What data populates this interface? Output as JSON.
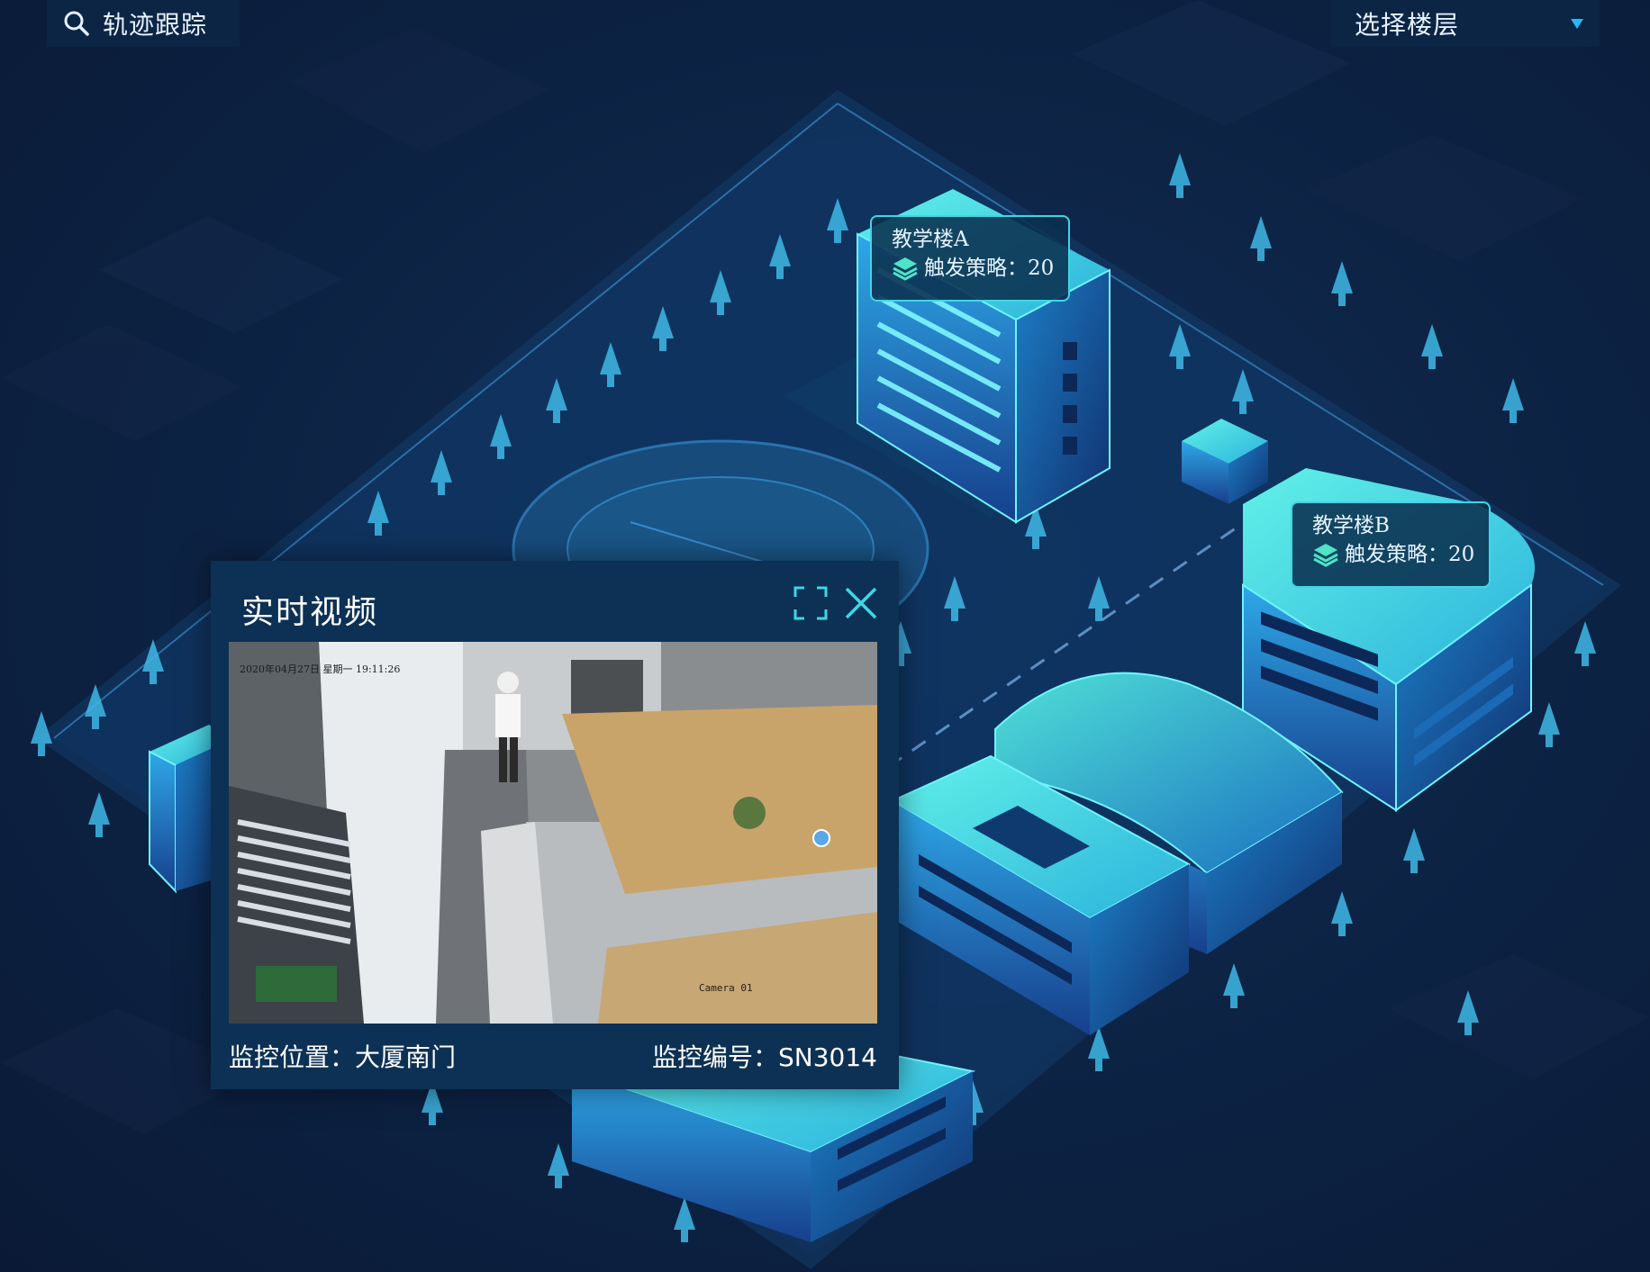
{
  "toolbar": {
    "search_label": "轨迹跟踪",
    "search_icon": "search-icon",
    "floor_select_value": "选择楼层",
    "floor_select_icon": "caret-down-icon"
  },
  "buildings": [
    {
      "name": "教学楼A",
      "strategy_label": "触发策略：",
      "strategy_count": "20",
      "icon": "layers-icon"
    },
    {
      "name": "教学楼B",
      "strategy_label": "触发策略：",
      "strategy_count": "20",
      "icon": "layers-icon"
    }
  ],
  "video_panel": {
    "title": "实时视频",
    "fullscreen_icon": "fullscreen-icon",
    "close_icon": "close-icon",
    "overlay_datetime": "2020年04月27日 星期一 19:11:26",
    "overlay_camera": "Camera 01",
    "location": "监控位置：大厦南门",
    "serial": "监控编号：SN3014"
  },
  "colors": {
    "background": "#0b1a33",
    "panel": "#0c3154",
    "accent": "#3fd6e6",
    "building_top": "#5ef0f0",
    "building_side": "#1a7fd0",
    "caret": "#29b6f6"
  }
}
